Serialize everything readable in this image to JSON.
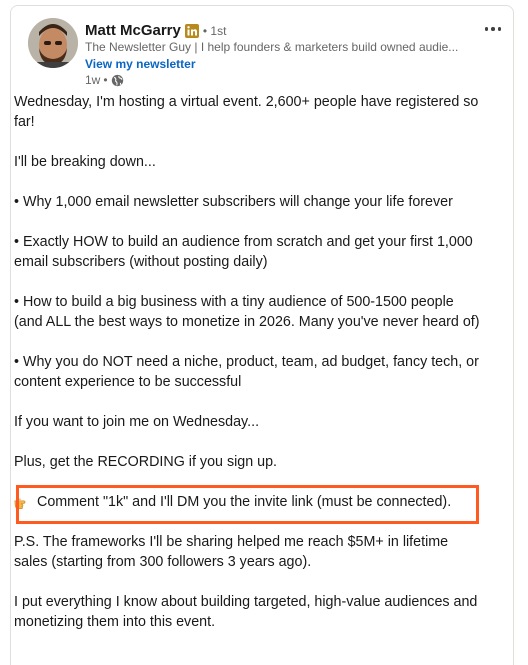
{
  "author": {
    "name": "Matt McGarry",
    "degree": "• 1st",
    "headline": "The Newsletter Guy | I help founders & marketers build owned audie...",
    "newsletter_link": "View my newsletter",
    "time_ago": "1w",
    "separator": "•"
  },
  "icons": {
    "avatar": "profile-photo",
    "badge": "linkedin-icon",
    "visibility": "globe-icon",
    "more": "more-options-icon",
    "comment_emoji": "pointing-hand-icon"
  },
  "colors": {
    "highlight_border": "#ff5a1f",
    "link": "#0a66c2",
    "linkedin_badge": "#b88a1d"
  },
  "post": {
    "paragraphs": [
      "Wednesday, I'm hosting a virtual event. 2,600+ people have registered so far!",
      "I'll be breaking down...",
      "• Why 1,000 email newsletter subscribers will change your life forever",
      "• Exactly HOW to build an audience from scratch and get your first 1,000 email subscribers (without posting daily)",
      "• How to build a big business with a tiny audience of 500-1500 people (and ALL the best ways to monetize in 2026. Many you've never heard of)",
      "• Why you do NOT need a niche, product, team, ad budget, fancy tech, or content experience to be successful",
      "If you want to join me on Wednesday...",
      "Plus, get the RECORDING if you sign up.",
      "Comment \"1k\" and I'll DM you the invite link (must be connected).",
      "P.S. The frameworks I'll be sharing helped me reach $5M+ in lifetime sales (starting from 300 followers 3 years ago).",
      "I put everything I know about building targeted, high-value audiences and monetizing them into this event."
    ]
  }
}
